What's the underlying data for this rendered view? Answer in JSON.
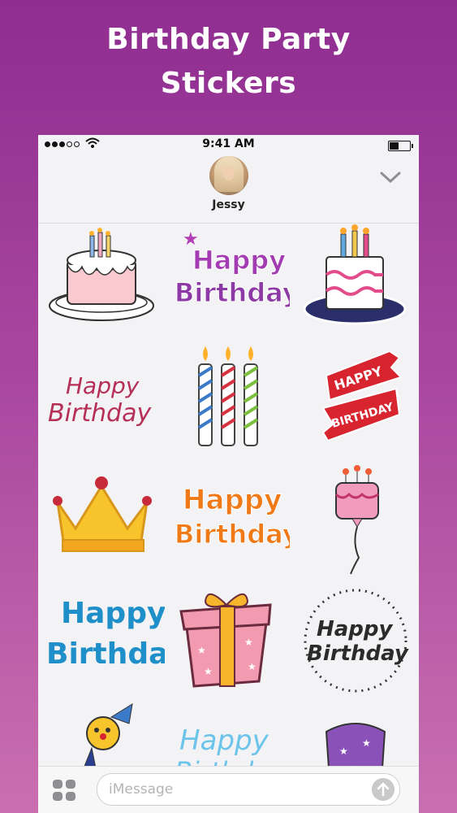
{
  "headline": {
    "line1": "Birthday Party",
    "line2": "Stickers"
  },
  "status_bar": {
    "time": "9:41 AM",
    "signal_bars": "●●●○○"
  },
  "contact": {
    "name": "Jessy"
  },
  "stickers": [
    {
      "name": "birthday-cake-candles",
      "text": ""
    },
    {
      "name": "happy-birthday-purple",
      "line1": "Happy",
      "line2": "Birthday"
    },
    {
      "name": "tall-cake-candles",
      "text": ""
    },
    {
      "name": "happy-birthday-script",
      "line1": "Happy",
      "line2": "Birthday"
    },
    {
      "name": "three-candles",
      "text": ""
    },
    {
      "name": "happy-birthday-banner",
      "line1": "HAPPY",
      "line2": "BIRTHDAY"
    },
    {
      "name": "crown",
      "text": ""
    },
    {
      "name": "happy-birthday-orange",
      "line1": "Happy",
      "line2": "Birthday"
    },
    {
      "name": "cake-balloon",
      "text": ""
    },
    {
      "name": "happy-birthday-blue",
      "line1": "Happy",
      "line2": "Birthday"
    },
    {
      "name": "gift-box",
      "text": ""
    },
    {
      "name": "happy-birthday-circle",
      "line1": "Happy",
      "line2": "Birthday"
    },
    {
      "name": "clown-toy",
      "text": ""
    },
    {
      "name": "happy-birthday-lightblue",
      "line1": "Happy",
      "line2": "Birthday"
    },
    {
      "name": "party-hat",
      "text": ""
    }
  ],
  "compose": {
    "placeholder": "iMessage"
  }
}
